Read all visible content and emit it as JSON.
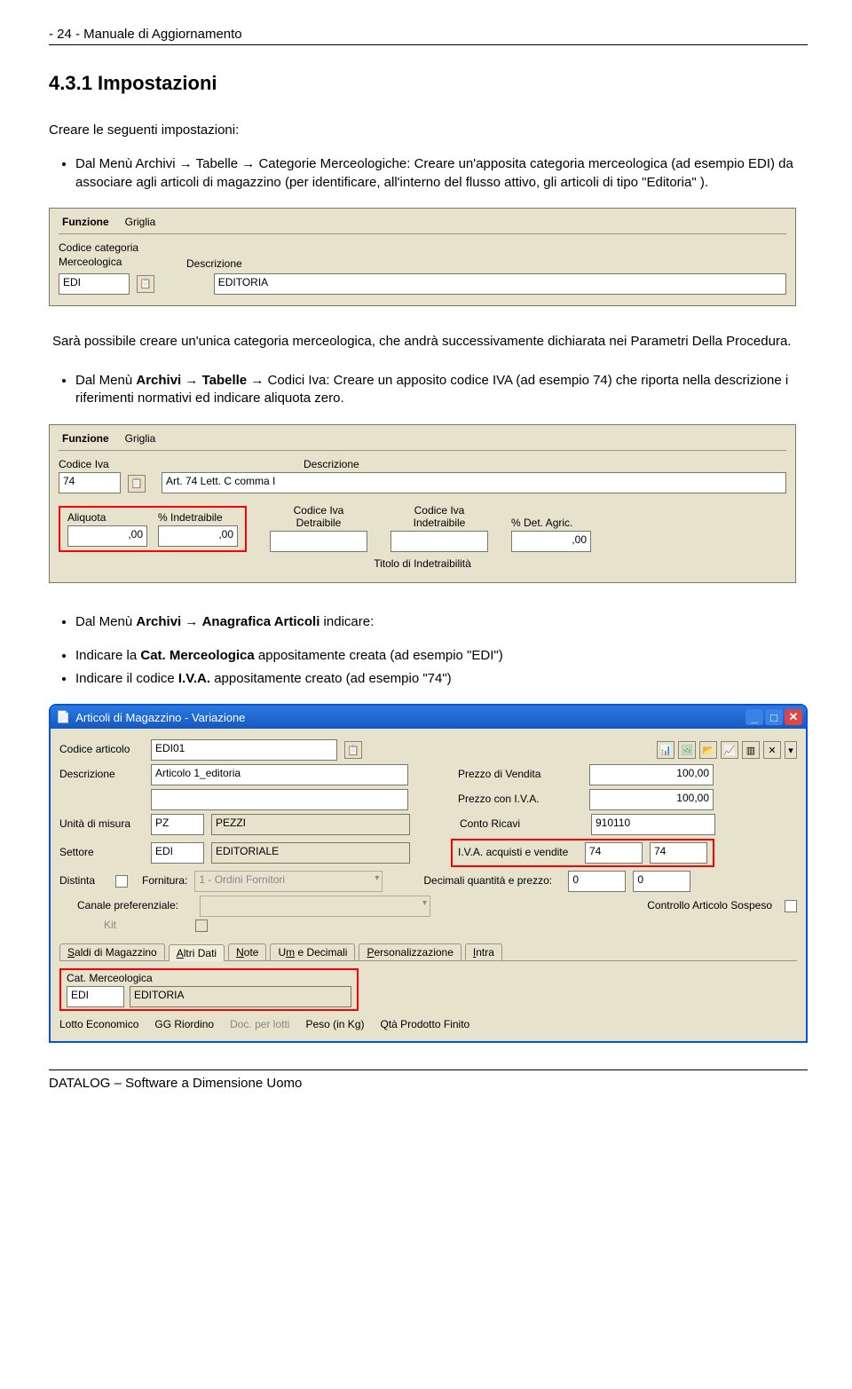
{
  "header": "- 24 -  Manuale di Aggiornamento",
  "section_title": "4.3.1  Impostazioni",
  "intro": "Creare le seguenti impostazioni:",
  "bullet1": "Dal Menù Archivi → Tabelle → Categorie Merceologiche: Creare un'apposita categoria merceologica (ad esempio EDI) da associare agli articoli di magazzino (per identificare, all'interno del flusso attivo, gli articoli di tipo \"Editoria\" ).",
  "panel1": {
    "tab_funzione": "Funzione",
    "tab_griglia": "Griglia",
    "lbl_codice": "Codice categoria",
    "lbl_merc": "Merceologica",
    "val_codice": "EDI",
    "lbl_desc": "Descrizione",
    "val_desc": "EDITORIA"
  },
  "note1": "Sarà possibile creare un'unica categoria merceologica, che andrà successivamente dichiarata nei Parametri Della Procedura.",
  "bullet2_prefix": "Dal Menù ",
  "bullet2_bold1": "Archivi",
  "bullet2_mid1": " → ",
  "bullet2_bold2": "Tabelle",
  "bullet2_mid2": " → Codici Iva: Creare un apposito codice IVA (ad esempio 74) che riporta nella descrizione i riferimenti normativi ed indicare aliquota zero.",
  "panel2": {
    "tab_funzione": "Funzione",
    "tab_griglia": "Griglia",
    "lbl_codiceiva": "Codice Iva",
    "val_codiceiva": "74",
    "lbl_desc": "Descrizione",
    "val_desc": "Art. 74 Lett. C comma I",
    "lbl_aliquota": "Aliquota",
    "val_aliquota": ",00",
    "lbl_indet": "% Indetraibile",
    "val_indet": ",00",
    "lbl_codivadet": "Codice Iva\nDetraibile",
    "val_codivadet": "",
    "lbl_codivaind": "Codice Iva\nIndetraibile",
    "val_codivaind": "",
    "lbl_detagr": "% Det. Agric.",
    "val_detagr": ",00",
    "lbl_titolo": "Titolo di Indetraibilità"
  },
  "bullet3_prefix": "Dal Menù ",
  "bullet3_bold1": "Archivi",
  "bullet3_mid1": " → ",
  "bullet3_bold2": "Anagrafica Articoli",
  "bullet3_suffix": " indicare:",
  "sub1_prefix": "Indicare la ",
  "sub1_bold": "Cat. Merceologica",
  "sub1_suffix": " appositamente creata (ad esempio \"EDI\")",
  "sub2_prefix": "Indicare il codice ",
  "sub2_bold": "I.V.A.",
  "sub2_suffix": " appositamente creato (ad esempio \"74\")",
  "panel3": {
    "title": "Articoli di Magazzino - Variazione",
    "lbl_codart": "Codice articolo",
    "val_codart": "EDI01",
    "lbl_desc": "Descrizione",
    "val_desc": "Articolo 1_editoria",
    "lbl_prezzo": "Prezzo di Vendita",
    "val_prezzo": "100,00",
    "lbl_prezzoiva": "Prezzo con I.V.A.",
    "val_prezzoiva": "100,00",
    "lbl_um": "Unità di misura",
    "val_um": "PZ",
    "val_um_desc": "PEZZI",
    "lbl_conto": "Conto Ricavi",
    "val_conto": "910110",
    "lbl_settore": "Settore",
    "val_settore": "EDI",
    "val_settore_desc": "EDITORIALE",
    "lbl_ivaacq": "I.V.A. acquisti e vendite",
    "val_iva1": "74",
    "val_iva2": "74",
    "lbl_distinta": "Distinta",
    "lbl_fornitura": "Fornitura:",
    "val_fornitura": "1 - Ordini Fornitori",
    "lbl_decimali": "Decimali quantità e prezzo:",
    "val_dec1": "0",
    "val_dec2": "0",
    "lbl_canale": "Canale preferenziale:",
    "lbl_kit": "Kit",
    "lbl_controllo": "Controllo Articolo Sospeso",
    "tabs": [
      "Saldi di Magazzino",
      "Altri Dati",
      "Note",
      "Um e Decimali",
      "Personalizzazione",
      "Intra"
    ],
    "lbl_catmerc": "Cat. Merceologica",
    "val_catmerc": "EDI",
    "val_catmerc_desc": "EDITORIA",
    "lbl_lotto": "Lotto Economico",
    "lbl_ggr": "GG Riordino",
    "lbl_docper": "Doc. per lotti",
    "lbl_peso": "Peso (in Kg)",
    "lbl_qtaprod": "Qtà Prodotto Finito"
  },
  "footer": "DATALOG – Software a Dimensione Uomo"
}
